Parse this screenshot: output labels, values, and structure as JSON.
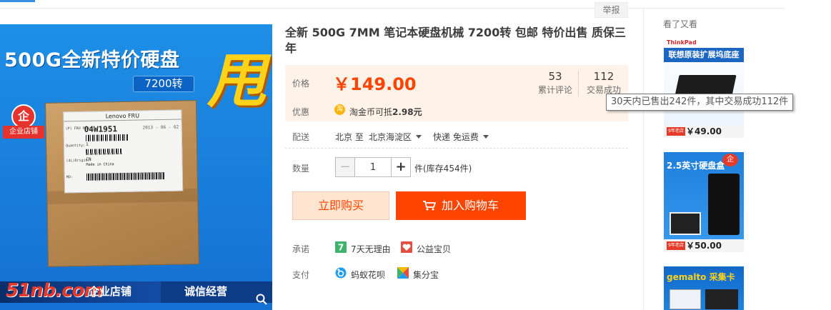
{
  "report_link": "举报",
  "gallery": {
    "banner_title": "500G全新特价硬盘",
    "rpm_pill": "7200转",
    "promo_glyph": "甩",
    "badge_icon": "企",
    "badge_text": "企业店铺",
    "label_head": "Lenovo    FRU",
    "label_pn_label": "(P) FRU P/N:",
    "label_pn": "04W1951",
    "label_date": "2013 - 06 - 02",
    "label_qty_label": "Quantity:",
    "label_qty": "1",
    "label_origin_label": "(4L)Origin:",
    "label_cn": "CN",
    "label_made": "Made in China",
    "label_mo": "MO:",
    "footer_watermark": "51nb.com",
    "footer_store": "企业店铺",
    "footer_honest": "诚信经营",
    "zoom_icon": "magnifier-icon"
  },
  "product": {
    "title": "全新 500G 7MM 笔记本硬盘机械 7200转 包邮 特价出售 质保三年",
    "price_label": "价格",
    "price": "￥149.00",
    "reviews_count": "53",
    "reviews_label": "累计评论",
    "sold_count": "112",
    "sold_label": "交易成功",
    "promo_label": "优惠",
    "coin_icon": "淘",
    "coin_text": "淘金币可抵",
    "coin_amount": "2.98元",
    "delivery_label": "配送",
    "delivery_from": "北京 至",
    "delivery_to": "北京海淀区",
    "shipping": "快递 免运费",
    "qty_label": "数量",
    "qty_value": "1",
    "qty_unit": "件(库存454件)",
    "buy_now": "立即购买",
    "add_to_cart": "加入购物车",
    "promise_label": "承诺",
    "promise_7day_icon": "7",
    "promise_7day": "7天无理由",
    "promise_charity": "公益宝贝",
    "payment_label": "支付",
    "pay_huabei": "蚂蚁花呗",
    "pay_jifenbao": "集分宝"
  },
  "tooltip": "30天内已售出242件，其中交易成功112件",
  "sidebar": {
    "title": "看了又看",
    "items": [
      {
        "brand": "ThinkPad",
        "headline": "联想原装扩展坞底座",
        "tag": "9年老店",
        "price": "￥49.00"
      },
      {
        "headline": "2.5英寸硬盘盒",
        "tag": "9年老店",
        "price": "￥50.00"
      },
      {
        "headline": "gemalto 采集卡"
      }
    ]
  },
  "colors": {
    "accent": "#ff4400",
    "price_bg": "#fff2e8",
    "buy_bg": "#ffe4d0",
    "tab_blue": "#3b8de1"
  }
}
